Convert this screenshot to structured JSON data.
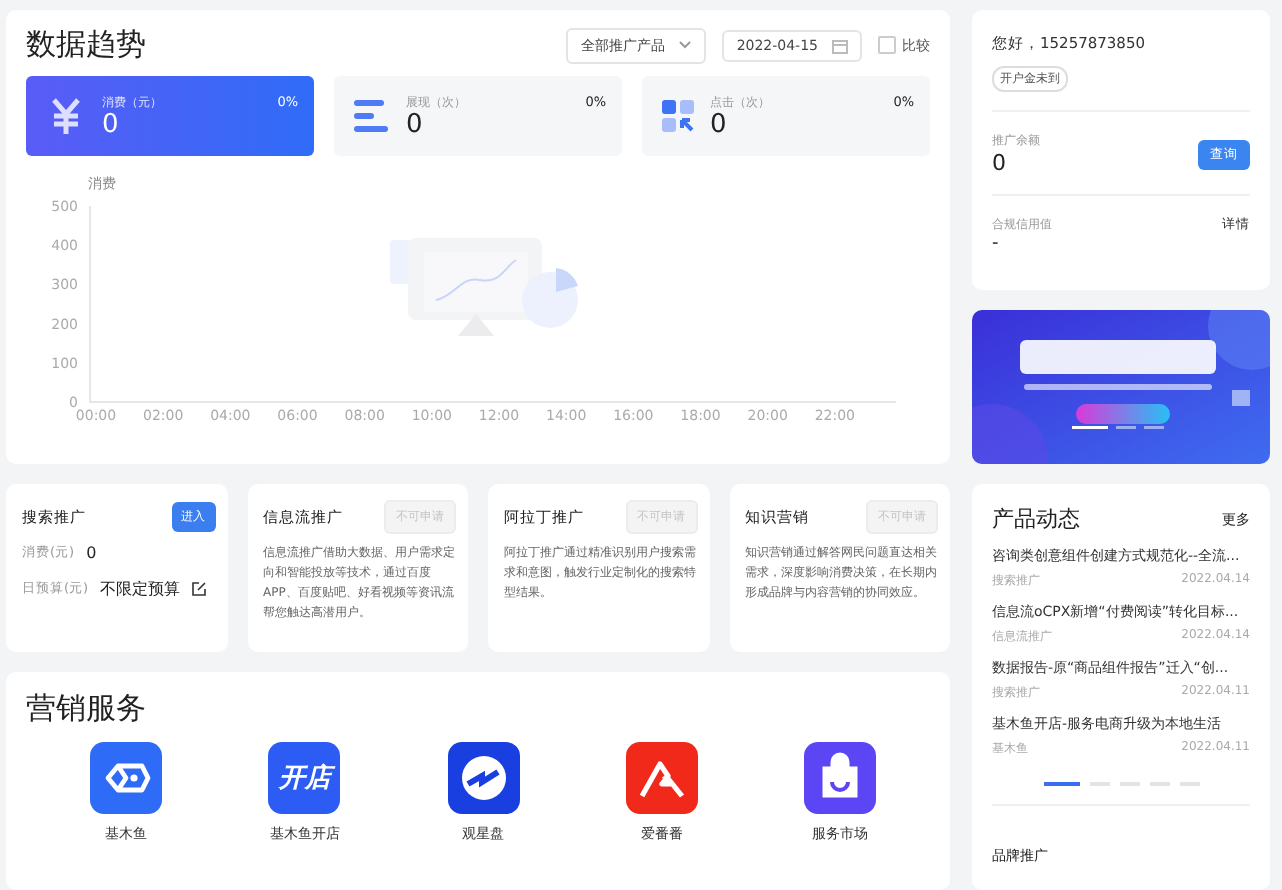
{
  "trend": {
    "title": "数据趋势",
    "product_select": {
      "value": "全部推广产品"
    },
    "date_field": {
      "value": "2022-04-15"
    },
    "compare": {
      "label": "比较",
      "checked": false
    },
    "stats": [
      {
        "kind": "cost",
        "label": "消费（元）",
        "value": "0",
        "change": "0%",
        "selected": true
      },
      {
        "kind": "impressions",
        "label": "展现（次）",
        "value": "0",
        "change": "0%",
        "selected": false
      },
      {
        "kind": "clicks",
        "label": "点击（次）",
        "value": "0",
        "change": "0%",
        "selected": false
      }
    ],
    "chart_data": {
      "type": "line",
      "ylabel": "消费",
      "categories": [
        "00:00",
        "02:00",
        "04:00",
        "06:00",
        "08:00",
        "10:00",
        "12:00",
        "14:00",
        "16:00",
        "18:00",
        "20:00",
        "22:00"
      ],
      "ylim": [
        0,
        500
      ],
      "yticks": [
        0,
        100,
        200,
        300,
        400,
        500
      ]
    }
  },
  "promotions": [
    {
      "kind": "search",
      "title": "搜索推广",
      "button": {
        "label": "进入",
        "disabled": false
      },
      "fields": [
        {
          "label": "消费(元)",
          "value": "0"
        },
        {
          "label": "日预算(元)",
          "value": "不限定预算"
        }
      ]
    },
    {
      "kind": "info",
      "title": "信息流推广",
      "button": {
        "label": "不可申请",
        "disabled": true
      },
      "description": "信息流推广借助大数据、用户需求定向和智能投放等技术，通过百度APP、百度贴吧、好看视频等资讯流帮您触达高潜用户。"
    },
    {
      "kind": "info",
      "title": "阿拉丁推广",
      "button": {
        "label": "不可申请",
        "disabled": true
      },
      "description": "阿拉丁推广通过精准识别用户搜索需求和意图，触发行业定制化的搜索特型结果。"
    },
    {
      "kind": "info",
      "title": "知识营销",
      "button": {
        "label": "不可申请",
        "disabled": true
      },
      "description": "知识营销通过解答网民问题直达相关需求，深度影响消费决策，在长期内形成品牌与内容营销的协同效应。"
    }
  ],
  "services": {
    "title": "营销服务",
    "items": [
      {
        "kind": "fish",
        "label": "基木鱼"
      },
      {
        "kind": "shop",
        "label": "基木鱼开店",
        "icon_text": "开店"
      },
      {
        "kind": "dial",
        "label": "观星盘"
      },
      {
        "kind": "peak",
        "label": "爱番番"
      },
      {
        "kind": "bag",
        "label": "服务市场"
      }
    ]
  },
  "account": {
    "greeting": "您好，15257873850",
    "tag": "开户金未到",
    "balance_label": "推广余额",
    "balance": "0",
    "query_button": "查询",
    "credit_label": "合规信用值",
    "details_link": "详情",
    "credit": "-"
  },
  "news": {
    "title": "产品动态",
    "more": "更多",
    "items": [
      {
        "title": "咨询类创意组件创建方式规范化--全流...",
        "source": "搜索推广",
        "date": "2022.04.14"
      },
      {
        "title": "信息流oCPX新增“付费阅读”转化目标...",
        "source": "信息流推广",
        "date": "2022.04.14"
      },
      {
        "title": "数据报告-原“商品组件报告”迁入“创...",
        "source": "搜索推广",
        "date": "2022.04.11"
      },
      {
        "title": "基木鱼开店-服务电商升级为本地生活",
        "source": "基木鱼",
        "date": "2022.04.11"
      }
    ],
    "pages": [
      {
        "selected": true
      },
      {
        "selected": false
      },
      {
        "selected": false
      },
      {
        "selected": false
      },
      {
        "selected": false
      }
    ],
    "brand_title": "品牌推广"
  }
}
